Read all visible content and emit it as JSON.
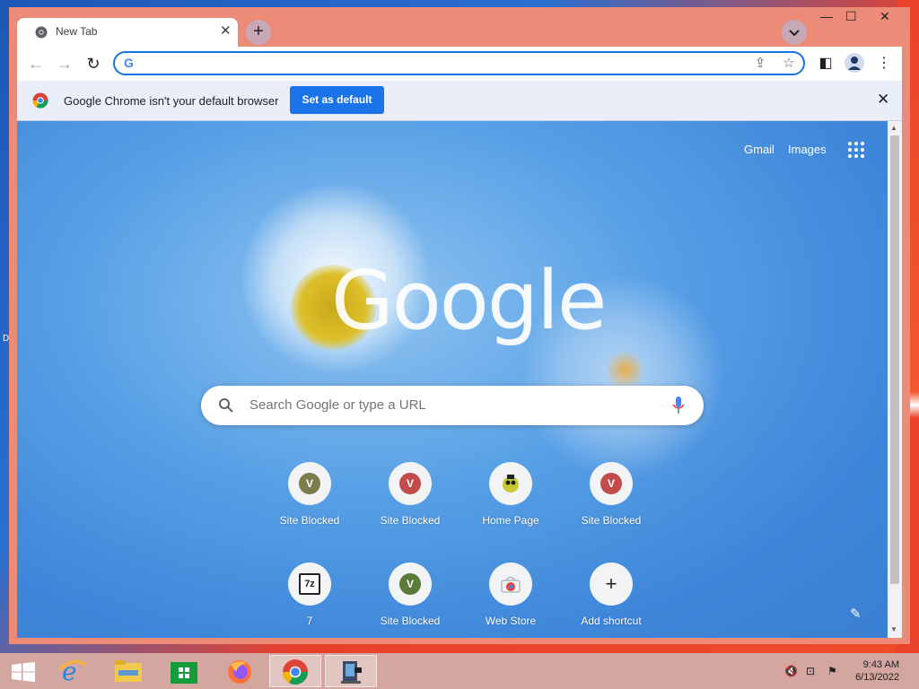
{
  "window": {
    "tab_title": "New Tab",
    "tab_close": "✕",
    "new_tab": "+",
    "minimize": "—",
    "maximize": "☐",
    "close": "✕"
  },
  "toolbar": {
    "back": "←",
    "forward": "→",
    "reload": "↻",
    "omnibox_value": "",
    "google_g": "G",
    "share": "⇪",
    "star": "☆",
    "sidepanel": "◧",
    "menu": "⋮"
  },
  "infobar": {
    "message": "Google Chrome isn't your default browser",
    "button": "Set as default",
    "close": "✕"
  },
  "ntp": {
    "gmail": "Gmail",
    "images": "Images",
    "logo": "Google",
    "search_placeholder": "Search Google or type a URL",
    "shortcuts": [
      {
        "label": "Site Blocked",
        "badge": "V",
        "color": "#7b7d4a"
      },
      {
        "label": "Site Blocked",
        "badge": "V",
        "color": "#c24b4b"
      },
      {
        "label": "Home Page",
        "badge": "",
        "color": "#c9c930"
      },
      {
        "label": "Site Blocked",
        "badge": "V",
        "color": "#c24b4b"
      },
      {
        "label": "7",
        "badge": "7z",
        "color": "#202124"
      },
      {
        "label": "Site Blocked",
        "badge": "V",
        "color": "#5a7a3a"
      },
      {
        "label": "Web Store",
        "badge": "",
        "color": "#e8453c"
      },
      {
        "label": "Add shortcut",
        "badge": "+",
        "color": "#202124"
      }
    ],
    "customize": "✎"
  },
  "desktop": {
    "edge_letter": "D"
  },
  "taskbar": {
    "time": "9:43 AM",
    "date": "6/13/2022"
  },
  "colors": {
    "accent": "#1a73e8",
    "frame": "#ec8b78",
    "taskbar": "#d4a6a0"
  }
}
